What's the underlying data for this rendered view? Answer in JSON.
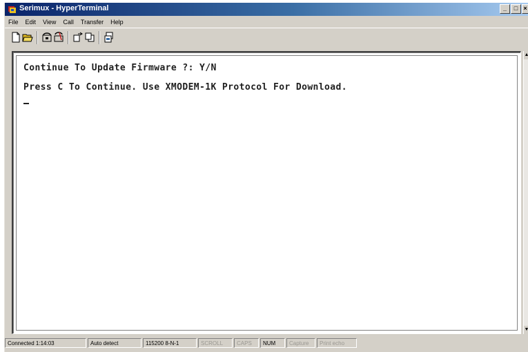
{
  "window": {
    "title": "Serimux - HyperTerminal",
    "buttons": {
      "minimize": "_",
      "maximize": "□",
      "close": "×"
    }
  },
  "menu": [
    "File",
    "Edit",
    "View",
    "Call",
    "Transfer",
    "Help"
  ],
  "toolbar": {
    "icons": [
      "new-connection-icon",
      "open-icon",
      "call-icon",
      "disconnect-icon",
      "send-file-icon",
      "receive-file-icon",
      "properties-icon"
    ]
  },
  "terminal": {
    "lines": [
      "Continue To Update Firmware ?: Y/N",
      "Press C To Continue. Use XMODEM-1K Protocol For Download."
    ]
  },
  "status": {
    "connected": "Connected 1:14:03",
    "detect": "Auto detect",
    "settings": "115200 8-N-1",
    "scroll": "SCROLL",
    "caps": "CAPS",
    "num": "NUM",
    "capture": "Capture",
    "print_echo": "Print echo"
  },
  "colors": {
    "titlebar_start": "#0a246a",
    "titlebar_end": "#a6caf0",
    "chrome": "#d4d0c8"
  }
}
